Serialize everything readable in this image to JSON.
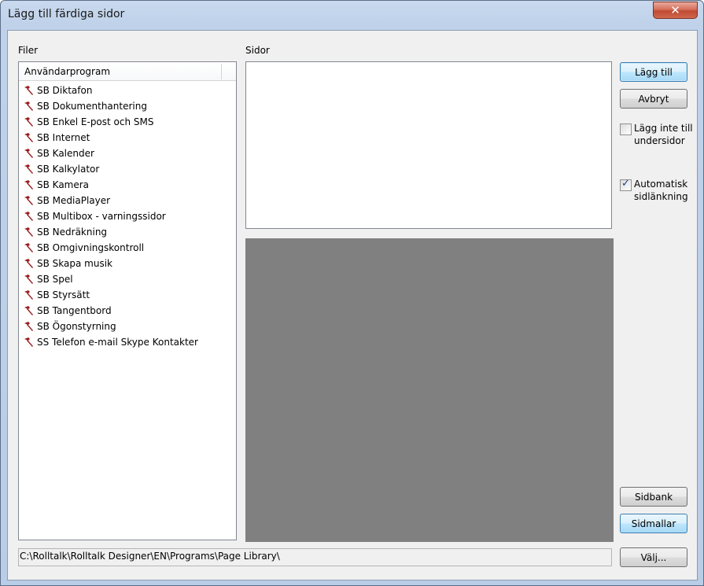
{
  "window": {
    "title": "Lägg till färdiga sidor",
    "close_glyph": "✕"
  },
  "files_panel": {
    "label": "Filer",
    "column_header": "Användarprogram",
    "items": [
      "SB Diktafon",
      "SB Dokumenthantering",
      "SB Enkel E-post och SMS",
      "SB Internet",
      "SB Kalender",
      "SB Kalkylator",
      "SB Kamera",
      "SB MediaPlayer",
      "SB Multibox - varningssidor",
      "SB Nedräkning",
      "SB Omgivningskontroll",
      "SB Skapa musik",
      "SB Spel",
      "SB Styrsätt",
      "SB Tangentbord",
      "SB Ögonstyrning",
      "SS Telefon e-mail Skype Kontakter"
    ],
    "item_icon": "hammer-icon"
  },
  "pages_panel": {
    "label": "Sidor"
  },
  "path": "C:\\Rolltalk\\Rolltalk Designer\\EN\\Programs\\Page Library\\",
  "buttons": {
    "add": "Lägg till",
    "cancel": "Avbryt",
    "page_bank": "Sidbank",
    "page_templates": "Sidmallar",
    "choose": "Välj..."
  },
  "options": {
    "no_subpages": {
      "label_line1": "Lägg inte till",
      "label_line2": "undersidor",
      "checked": false
    },
    "auto_link": {
      "label_line1": "Automatisk",
      "label_line2": "sidlänkning",
      "checked": true
    }
  },
  "colors": {
    "preview_bg": "#808080",
    "icon_hammer": "#9b1c1c"
  }
}
